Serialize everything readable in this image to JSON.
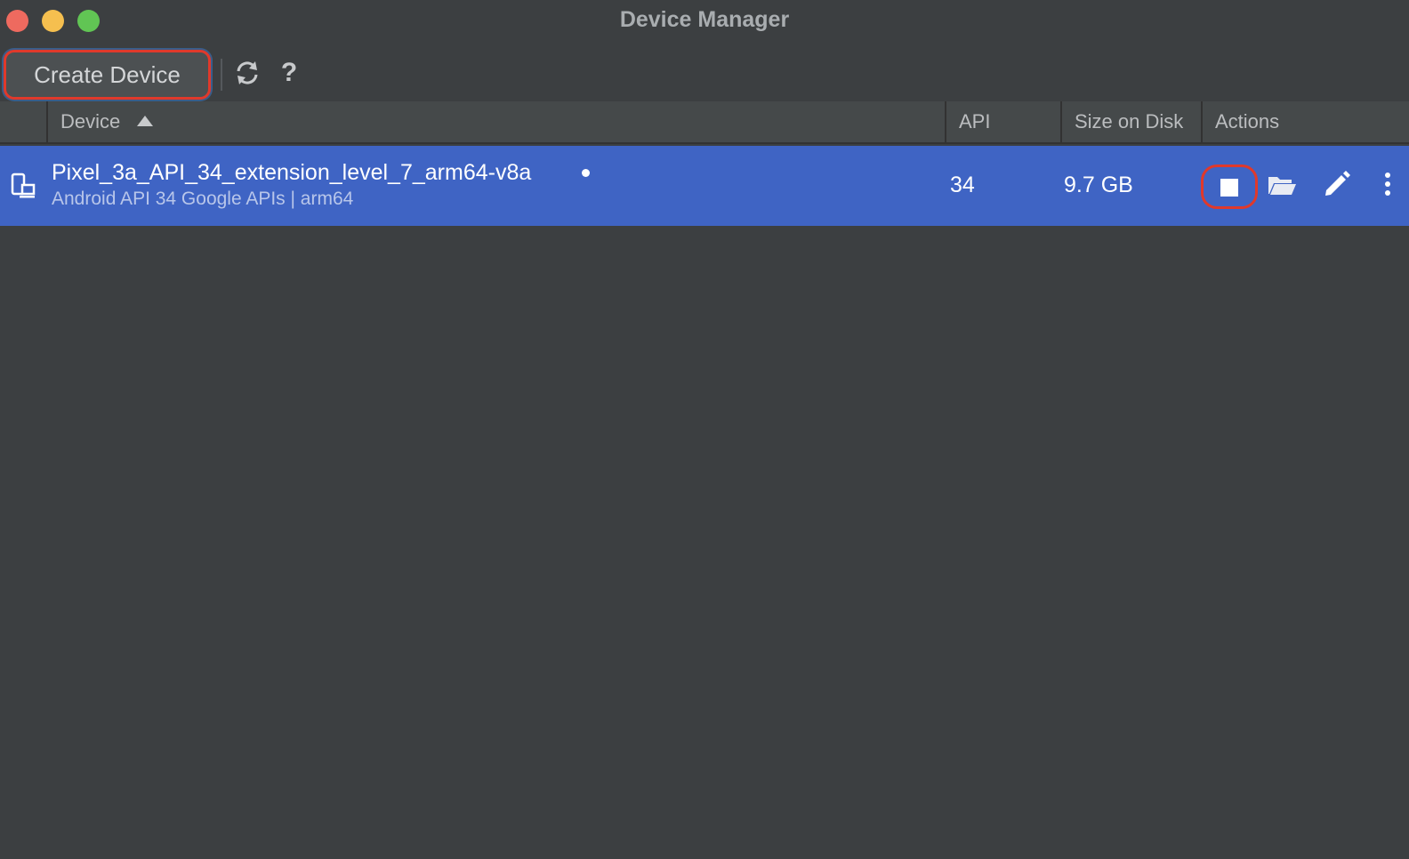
{
  "window": {
    "title": "Device Manager"
  },
  "toolbar": {
    "create_label": "Create Device",
    "help_label": "?"
  },
  "table": {
    "columns": {
      "device": "Device",
      "api": "API",
      "size": "Size on Disk",
      "actions": "Actions"
    },
    "sort": {
      "column": "Device",
      "direction": "ascending"
    },
    "rows": [
      {
        "name": "Pixel_3a_API_34_extension_level_7_arm64-v8a",
        "subtitle": "Android API 34 Google APIs | arm64",
        "api": "34",
        "size": "9.7 GB",
        "status": "online",
        "actions": [
          "stop-icon",
          "folder-icon",
          "edit-icon",
          "more-vertical-icon"
        ]
      }
    ]
  },
  "colors": {
    "background": "#3c3f41",
    "header": "#45494a",
    "selected_row": "#3f64c4",
    "highlight": "#e0392b"
  }
}
